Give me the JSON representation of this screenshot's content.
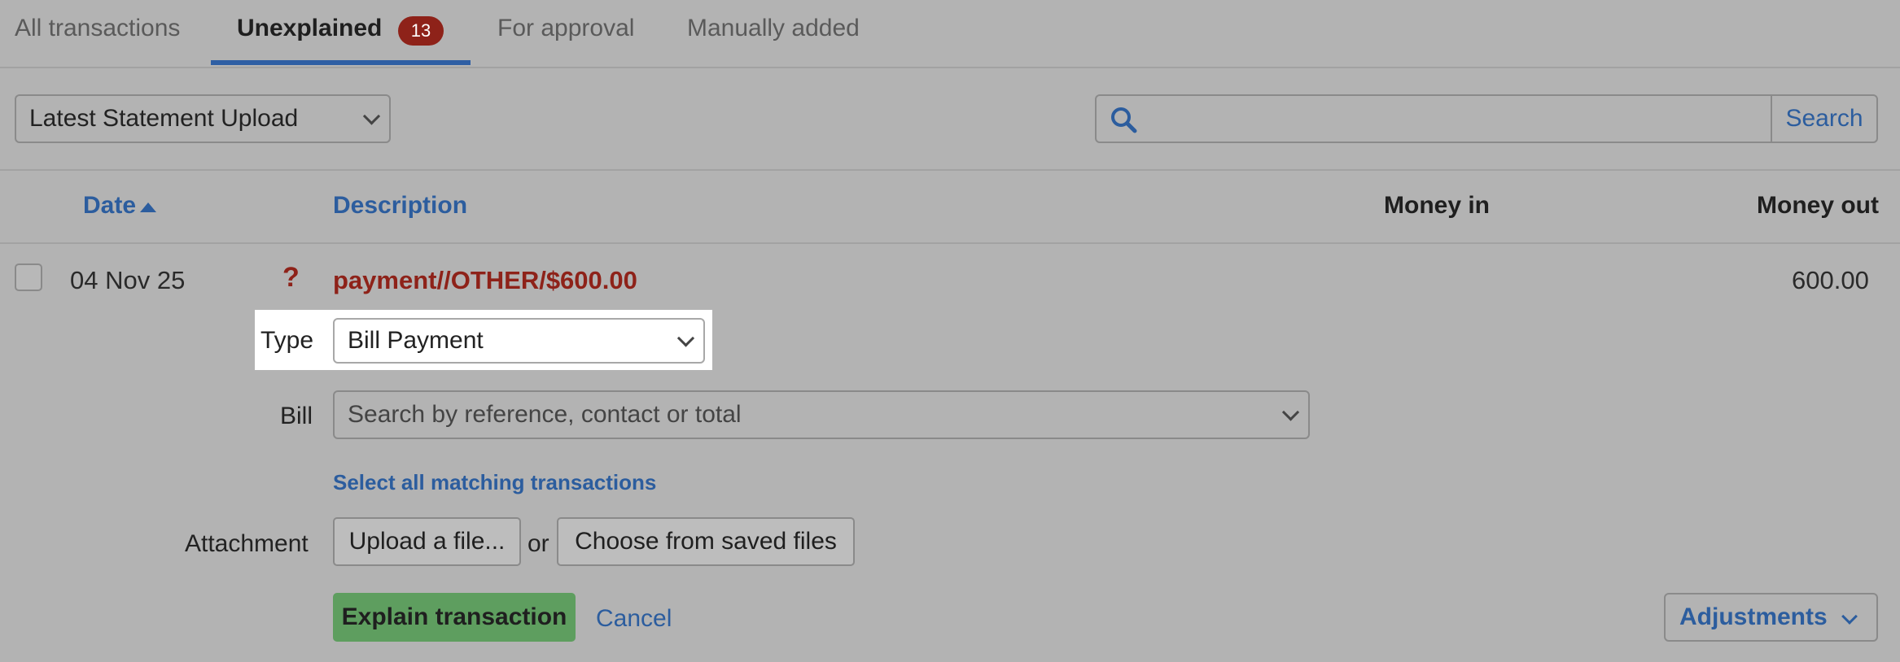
{
  "tabs": [
    {
      "label": "All transactions"
    },
    {
      "label": "Unexplained",
      "badge": "13"
    },
    {
      "label": "For approval"
    },
    {
      "label": "Manually added"
    }
  ],
  "filter": {
    "selected": "Latest Statement Upload"
  },
  "search": {
    "button_label": "Search",
    "placeholder": ""
  },
  "table": {
    "headers": {
      "date": "Date",
      "description": "Description",
      "money_in": "Money in",
      "money_out": "Money out"
    }
  },
  "row": {
    "date": "04 Nov 25",
    "status_icon": "?",
    "description": "payment//OTHER/$600.00",
    "money_out": "600.00"
  },
  "form": {
    "type_label": "Type",
    "type_value": "Bill Payment",
    "bill_label": "Bill",
    "bill_placeholder": "Search by reference, contact or total",
    "select_all_link": "Select all matching transactions",
    "attachment_label": "Attachment",
    "upload_button": "Upload a file...",
    "or_text": "or",
    "choose_saved_button": "Choose from saved files",
    "explain_button": "Explain transaction",
    "cancel_link": "Cancel",
    "adjustments_button": "Adjustments"
  },
  "colors": {
    "accent_blue": "#2c5d9e",
    "error_red": "#8e2219",
    "primary_green": "#5e9e5f"
  }
}
